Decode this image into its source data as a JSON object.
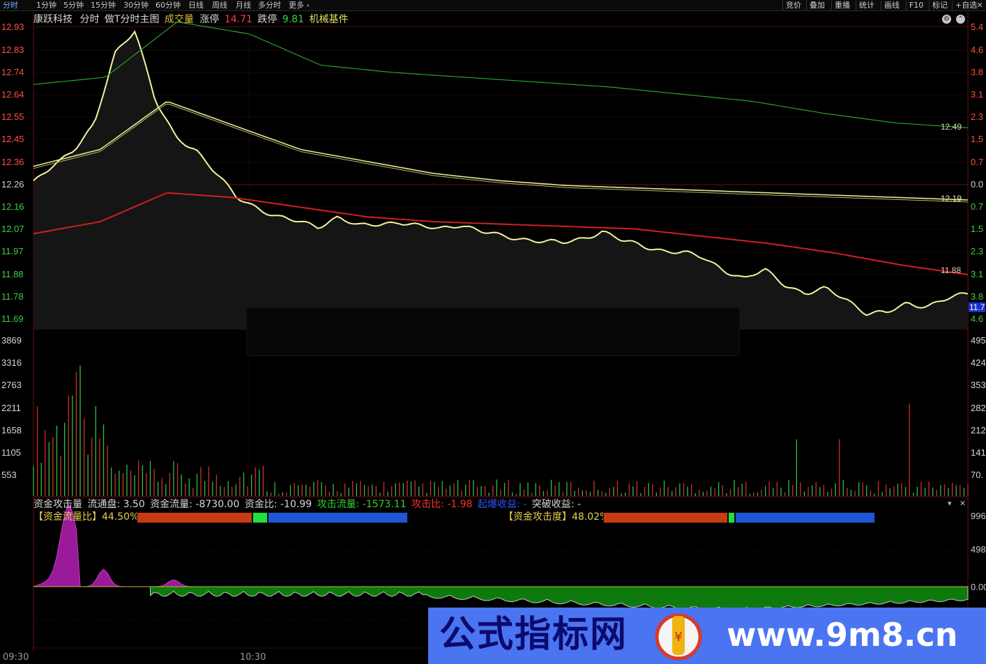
{
  "periods": [
    {
      "label": "分时",
      "active": true
    },
    {
      "label": "1分钟"
    },
    {
      "label": "5分钟"
    },
    {
      "label": "15分钟"
    },
    {
      "label": "30分钟"
    },
    {
      "label": "60分钟"
    },
    {
      "label": "日线"
    },
    {
      "label": "周线"
    },
    {
      "label": "月线"
    },
    {
      "label": "多分时"
    },
    {
      "label": "更多 ›"
    }
  ],
  "toolbar": [
    "竞价",
    "叠加",
    "重播",
    "统计",
    "画线",
    "F10",
    "标记",
    "+自选"
  ],
  "title": {
    "name": "康跃科技",
    "mode": "分时",
    "formula": "做T分时主图",
    "volume_label": "成交量",
    "limit_up_label": "涨停",
    "limit_up": "14.71",
    "limit_down_label": "跌停",
    "limit_down": "9.81",
    "sector": "机械基件"
  },
  "price_axis_left": [
    "12.93",
    "12.83",
    "12.74",
    "12.64",
    "12.55",
    "12.45",
    "12.36",
    "12.26",
    "12.16",
    "12.07",
    "11.97",
    "11.88",
    "11.78",
    "11.69"
  ],
  "price_axis_right": [
    "5.4",
    "4.6",
    "3.8",
    "3.1",
    "2.3",
    "1.5",
    "0.7",
    "0.0",
    "0.7",
    "1.5",
    "2.3",
    "3.1",
    "3.8",
    "4.6"
  ],
  "volume_axis_left": [
    "3869",
    "3316",
    "2763",
    "2211",
    "1658",
    "1105",
    "553"
  ],
  "volume_axis_right": [
    "495",
    "424",
    "353",
    "282",
    "212",
    "141",
    "70."
  ],
  "line_tags": {
    "top": "12.49",
    "mid": "12.19",
    "low": "11.88",
    "last": "11.7"
  },
  "indicator": {
    "name": "资金攻击量",
    "float_label": "流通盘:",
    "float_value": "3.50",
    "flow_label": "资金流量:",
    "flow_value": "-8730.00",
    "ratio_label": "资金比:",
    "ratio_value": "-10.99",
    "attack_flow_label": "攻击流量:",
    "attack_flow_value": "-1573.11",
    "attack_ratio_label": "攻击比:",
    "attack_ratio_value": "-1.98",
    "breakout_label": "起爆收益:",
    "breakout_value": "-",
    "break_label": "突破收益:",
    "break_value": "-"
  },
  "gauge1": {
    "label": "【资金流量比】",
    "value": "44.50",
    "unit": "%买"
  },
  "gauge2": {
    "label": "【资金攻击度】",
    "value": "48.02",
    "unit": "%买"
  },
  "indicator_axis": [
    "996",
    "498",
    "0.00"
  ],
  "time_axis": [
    "09:30",
    "10:30"
  ],
  "watermark": {
    "text": "公式指标网",
    "url": "www.9m8.cn"
  },
  "chart_data": {
    "type": "line",
    "x_range": [
      "09:30",
      "15:00"
    ],
    "series": [
      {
        "values": [
          12.26,
          12.34,
          12.4,
          12.5,
          12.8,
          12.9,
          12.6,
          12.45,
          12.4,
          12.3,
          12.2,
          12.16,
          12.12,
          12.1,
          12.08,
          12.12,
          12.08,
          12.09,
          12.1,
          12.08,
          12.07,
          12.09,
          12.06,
          12.04,
          12.03,
          12.02,
          12.01,
          12.03,
          12.06,
          12.02,
          12.0,
          11.98,
          11.97,
          11.95,
          11.9,
          11.86,
          11.9,
          11.84,
          11.8,
          11.82,
          11.78,
          11.72,
          11.72,
          11.76,
          11.75,
          11.78,
          11.8
        ]
      },
      {
        "values": [
          12.33,
          12.4,
          12.6,
          12.5,
          12.4,
          12.35,
          12.3,
          12.27,
          12.25,
          12.24,
          12.23,
          12.22,
          12.21,
          12.2,
          12.19
        ]
      },
      {
        "values": [
          12.05,
          12.1,
          12.22,
          12.2,
          12.16,
          12.12,
          12.1,
          12.09,
          12.08,
          12.07,
          12.04,
          12.01,
          11.97,
          11.92,
          11.88
        ]
      },
      {
        "values": [
          12.67,
          12.7,
          12.93,
          12.88,
          12.75,
          12.72,
          12.7,
          12.68,
          12.66,
          12.63,
          12.6,
          12.55,
          12.51,
          12.49
        ]
      }
    ]
  }
}
